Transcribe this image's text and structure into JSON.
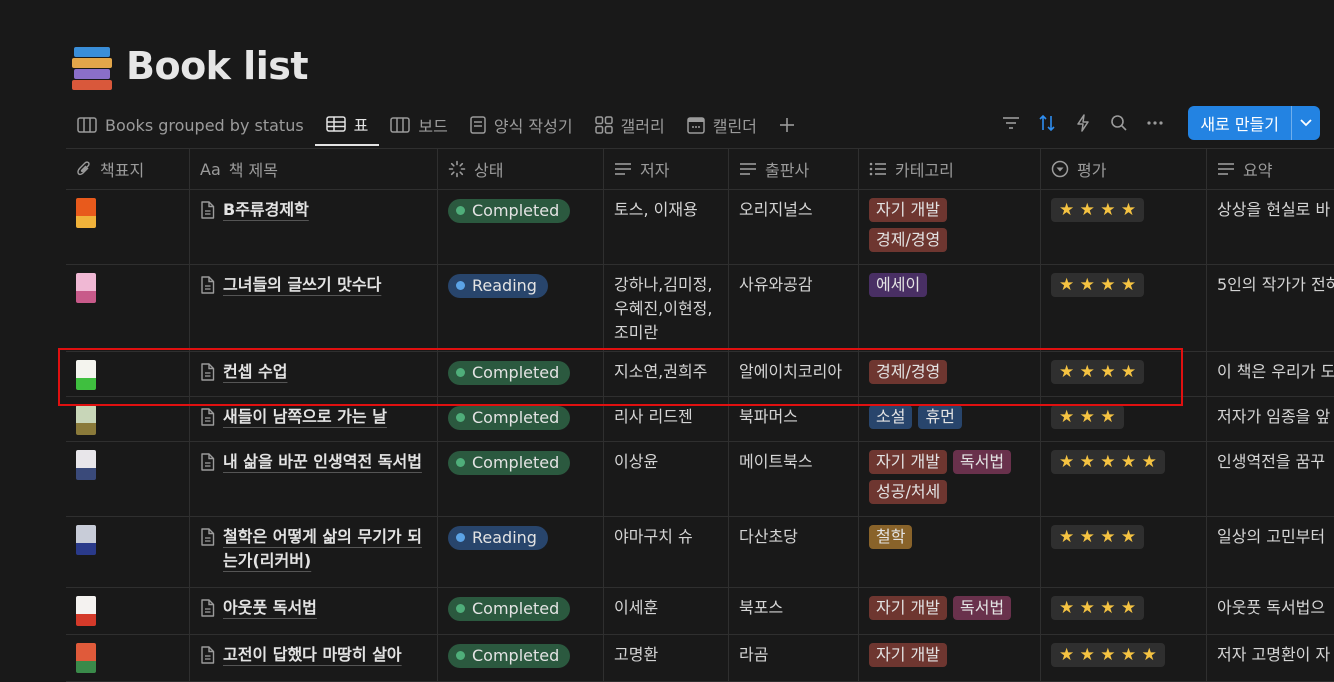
{
  "page": {
    "title": "Book list",
    "icon": "books-icon"
  },
  "tabs": [
    {
      "label": "Books grouped by status",
      "icon": "board-view-icon"
    },
    {
      "label": "표",
      "icon": "table-view-icon",
      "active": true
    },
    {
      "label": "보드",
      "icon": "board-view-icon"
    },
    {
      "label": "양식 작성기",
      "icon": "form-icon"
    },
    {
      "label": "갤러리",
      "icon": "gallery-icon"
    },
    {
      "label": "캘린더",
      "icon": "calendar-icon"
    }
  ],
  "toolbar": {
    "new_label": "새로 만들기",
    "accent": "#2383e2"
  },
  "columns": [
    {
      "label": "책표지",
      "icon": "paperclip-icon"
    },
    {
      "label": "책 제목",
      "icon": "title-aa-icon",
      "prefix": "Aa"
    },
    {
      "label": "상태",
      "icon": "status-icon"
    },
    {
      "label": "저자",
      "icon": "text-lines-icon"
    },
    {
      "label": "출판사",
      "icon": "text-lines-icon"
    },
    {
      "label": "카테고리",
      "icon": "list-icon"
    },
    {
      "label": "평가",
      "icon": "select-icon"
    },
    {
      "label": "요약",
      "icon": "text-lines-icon"
    }
  ],
  "rows": [
    {
      "title": "B주류경제학",
      "status": "Completed",
      "author": "토스, 이재용",
      "publisher": "오리지널스",
      "tags": [
        "자기 개발",
        "경제/경영"
      ],
      "rating": "★ ★ ★ ★",
      "summary": "상상을 현실로 바"
    },
    {
      "title": "그녀들의 글쓰기 맛수다",
      "status": "Reading",
      "author": "강하나,김미정,우혜진,이현정,조미란",
      "publisher": "사유와공감",
      "tags": [
        "에세이"
      ],
      "rating": "★ ★ ★ ★",
      "summary": "5인의 작가가 전하"
    },
    {
      "title": "컨셉 수업",
      "status": "Completed",
      "author": "지소연,권희주",
      "publisher": "알에이치코리아",
      "tags": [
        "경제/경영"
      ],
      "rating": "★ ★ ★ ★",
      "summary": "이 책은 우리가 도"
    },
    {
      "title": "새들이 남쪽으로 가는 날",
      "status": "Completed",
      "author": "리사 리드젠",
      "publisher": "북파머스",
      "tags": [
        "소설",
        "휴먼"
      ],
      "rating": "★ ★ ★",
      "summary": " 저자가 임종을 앞"
    },
    {
      "title": "내 삶을 바꾼 인생역전 독서법",
      "status": "Completed",
      "author": "이상윤",
      "publisher": "메이트북스",
      "tags": [
        "자기 개발",
        "독서법",
        "성공/처세"
      ],
      "rating": "★ ★ ★ ★ ★",
      "summary": "인생역전을 꿈꾸"
    },
    {
      "title": "철학은 어떻게 삶의 무기가 되는가(리커버)",
      "status": "Reading",
      "author": "야마구치 슈",
      "publisher": "다산초당",
      "tags": [
        "철학"
      ],
      "rating": "★ ★ ★ ★",
      "summary": "일상의 고민부터"
    },
    {
      "title": "아웃풋 독서법",
      "status": "Completed",
      "author": "이세훈",
      "publisher": "북포스",
      "tags": [
        "자기 개발",
        "독서법"
      ],
      "rating": "★ ★ ★ ★",
      "summary": "아웃풋 독서법으"
    },
    {
      "title": "고전이 답했다 마땅히 살아",
      "status": "Completed",
      "author": "고명환",
      "publisher": "라곰",
      "tags": [
        "자기 개발"
      ],
      "rating": "★ ★ ★ ★ ★",
      "summary": "저자 고명환이 자"
    }
  ],
  "colors": {
    "tag_자기 개발": "#6e3630",
    "tag_경제/경영": "#6e3630",
    "tag_에세이": "#492f64",
    "tag_소설": "#28456c",
    "tag_휴먼": "#28456c",
    "tag_독서법": "#69314c",
    "tag_성공/처세": "#6e3630",
    "tag_철학": "#89632a"
  }
}
